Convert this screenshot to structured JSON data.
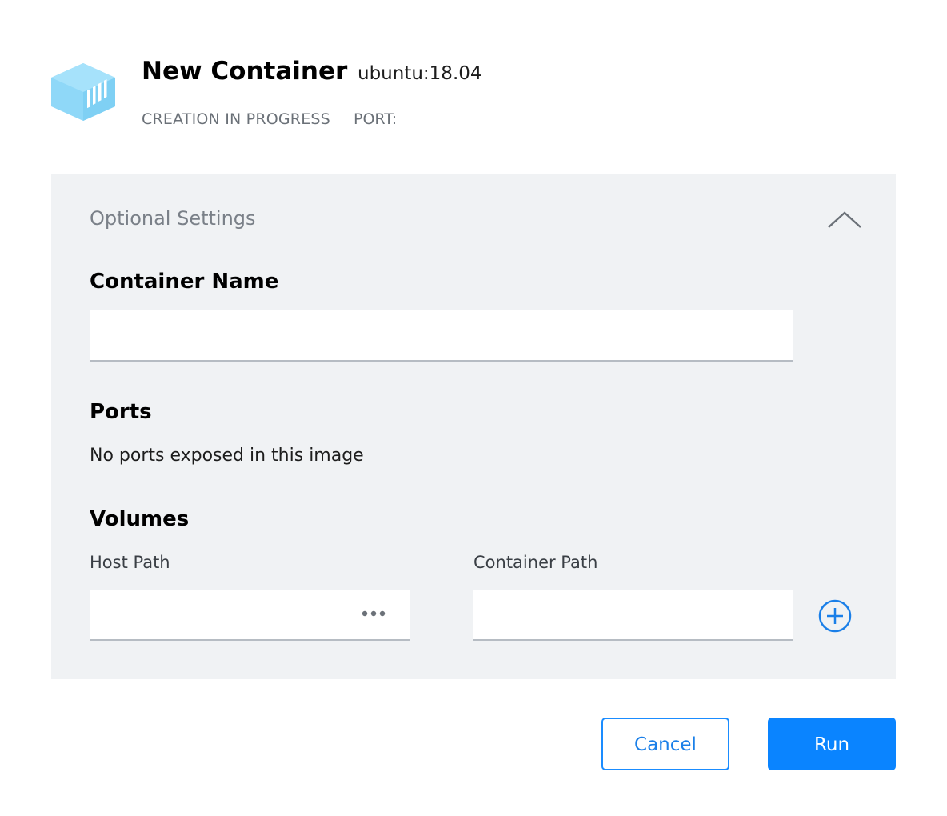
{
  "header": {
    "icon": "container-cube-icon",
    "title": "New Container",
    "image_tag": "ubuntu:18.04",
    "status": "CREATION IN PROGRESS",
    "port_label": "PORT:"
  },
  "panel": {
    "title": "Optional Settings",
    "collapse_icon": "chevron-up-icon",
    "container_name": {
      "heading": "Container Name",
      "value": ""
    },
    "ports": {
      "heading": "Ports",
      "message": "No ports exposed in this image"
    },
    "volumes": {
      "heading": "Volumes",
      "host_path_label": "Host Path",
      "host_path_value": "",
      "browse_icon": "more-dots-icon",
      "container_path_label": "Container Path",
      "container_path_value": "",
      "add_icon": "plus-circle-icon"
    }
  },
  "footer": {
    "cancel_label": "Cancel",
    "run_label": "Run"
  },
  "colors": {
    "accent": "#0a84ff",
    "icon_cube": "#8fd8f8",
    "panel_bg": "#f0f2f4",
    "muted_text": "#6b7178"
  }
}
